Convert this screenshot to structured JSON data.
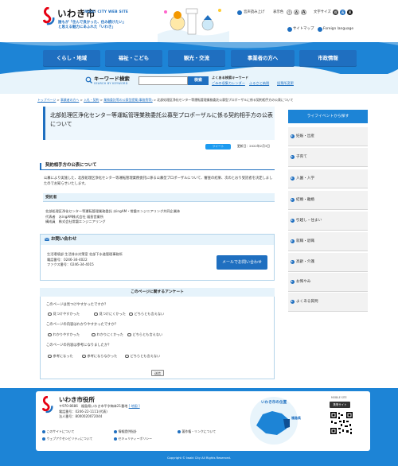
{
  "header": {
    "logo_text": "いわき市",
    "logo_sub": "IWAKI CITY WEB SITE",
    "tagline_1": "誰もが「住んで良かった、住み続けたい」",
    "tagline_2": "と思える魅力にあふれた「いわき」",
    "voice": "音声読み上げ",
    "display_label": "表示色",
    "text_size_label": "文字サイズ",
    "size_small": "小",
    "size_medium": "A",
    "size_large": "A",
    "color_std": "標",
    "color_blue": "青",
    "color_black": "黒",
    "sitemap": "サイトマップ",
    "foreign": "Foreign language"
  },
  "nav": {
    "items": [
      "くらし・地域",
      "福祉・こども",
      "観光・交流",
      "事業者の方へ",
      "市政情報"
    ]
  },
  "search": {
    "title": "キーワード検索",
    "subtitle": "SEARCH BY KEYWORD",
    "placeholder": "",
    "button": "検索",
    "often_label": "よくある検索キーワード",
    "often_links": [
      "ごみの収集カレンダー",
      "ふるさと納税",
      "投票所変更"
    ]
  },
  "breadcrumb": [
    "トップページ",
    "事業者の方へ",
    "入札・契約",
    "業務委託等の公募型提案(事務費等)",
    "北部処理区浄化センター等運転管理業務委託公募型プロポーザルに係る契約相手方の公表について"
  ],
  "page": {
    "title": "北部処理区浄化センター等運転管理業務委託公募型プロポーザルに係る契約相手方の公表について",
    "share": "ツイート",
    "updated": "更新日：2022年2月3日"
  },
  "section1": {
    "heading": "契約相手方の公表について",
    "body": "公募により実施した、北部処理区浄化センター等運転管理業務委託に係る公募型プロポーザルについて、審査の結果、次のとおり受託者を決定しましたのでお知らせいたします。",
    "recipient_heading": "受託者",
    "recipient_lines": [
      "北部処理区浄化センター等運転管理業務委託 水ingAM・常磐エンジニアリング共同企業体",
      "代表者　水ingAM株式会社 福島営業所",
      "構成員　株式会社常磐エンジニアリング"
    ]
  },
  "inquiry": {
    "heading": "お問い合わせ",
    "lines": [
      "生活環境部 生活排水対策室 北部下水道管理事務所",
      "電話番号：0246-34-4022",
      "ファクス番号：0246-34-4015"
    ],
    "mail_button": "メールでお問い合わせ"
  },
  "survey": {
    "title": "このページに関するアンケート",
    "questions": [
      {
        "q": "このページは見つけやすかったですか？",
        "options": [
          "見つけやすかった",
          "見つけにくかった",
          "どちらとも言えない"
        ]
      },
      {
        "q": "このページの内容はわかりやすかったですか？",
        "options": [
          "わかりやすかった",
          "わかりにくかった",
          "どちらとも言えない"
        ]
      },
      {
        "q": "このページの内容は参考になりましたか？",
        "options": [
          "参考になった",
          "参考にならなかった",
          "どちらとも言えない"
        ]
      }
    ],
    "submit": "送信"
  },
  "sidebar": {
    "heading": "ライフイベントから探す",
    "items": [
      "妊娠・出産",
      "子育て",
      "入園・入学",
      "結婚・離婚",
      "引越し・住まい",
      "就職・退職",
      "高齢・介護",
      "お悔やみ",
      "よくある質問"
    ]
  },
  "footer": {
    "name": "いわき市役所",
    "postal": "〒970-8686　福島県いわき市平字梅本21番地",
    "map_link": "[ 地図 ]",
    "tel": "電話番号：0246-22-1111(代表)",
    "corp_no": "法人番号：8000020072044",
    "links": [
      "このサイトについて",
      "情報提供指針",
      "著作権・リンクについて",
      "ウェブアクセシビリティについて",
      "セキュリティーポリシー"
    ],
    "map_caption": "いわき市の位置",
    "map_label": "福島県",
    "mobile_label": "MOBILE SITE",
    "mobile_head": "携帯サイト",
    "copyright": "Copyright © Iwaki City All Rights Reserved."
  },
  "colors": {
    "accent": "#1f6fc0",
    "nav_bg": "#1d84d6",
    "soft": "#e6f3fb"
  }
}
